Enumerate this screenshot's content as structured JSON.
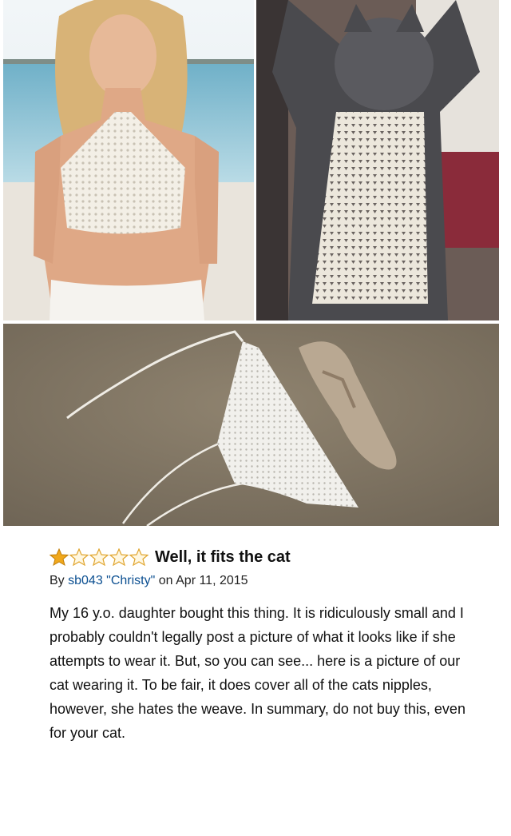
{
  "review": {
    "rating": 1,
    "max_rating": 5,
    "title": "Well, it fits the cat",
    "byline_prefix": "By ",
    "author": "sb043 \"Christy\"",
    "date_text": " on Apr 11, 2015",
    "body": "My 16 y.o. daughter bought this thing. It is ridiculously small and I probably couldn't legally post a picture of what it looks like if she attempts to wear it. But, so you can see... here is a picture of our cat wearing it. To be fair, it does cover all of the cats nipples, however, she hates the weave. In summary, do not buy this, even for your cat."
  },
  "colors": {
    "star_filled": "#f0a81c",
    "star_empty": "#f4c65a",
    "author_link": "#0b4f91",
    "sand": "#8a7d6b"
  },
  "icons": {
    "filled_star": "star-filled-icon",
    "empty_star": "star-empty-icon"
  }
}
